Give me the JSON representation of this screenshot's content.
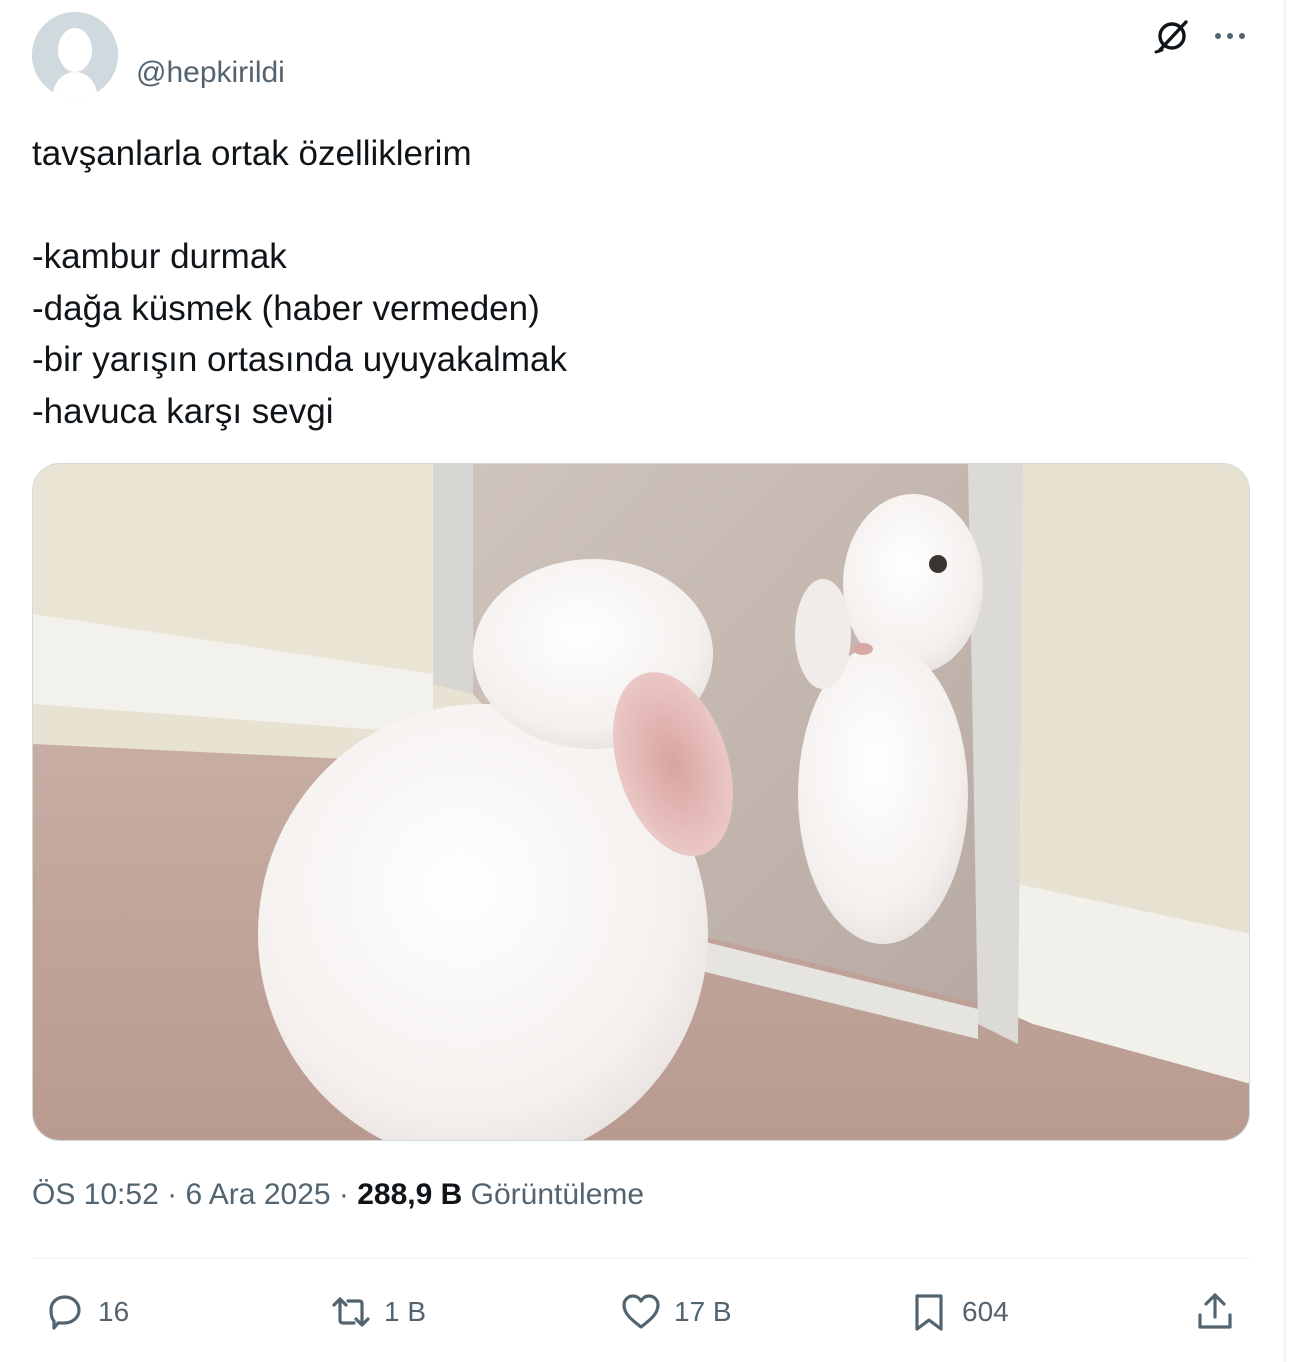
{
  "user": {
    "handle": "@hepkirildi"
  },
  "icons": {
    "grok": "grok-icon",
    "more": "more-icon",
    "reply": "reply-icon",
    "retweet": "retweet-icon",
    "like": "heart-icon",
    "bookmark": "bookmark-icon",
    "share": "share-icon"
  },
  "tweet": {
    "text": "tavşanlarla ortak özelliklerim\n\n-kambur durmak\n-dağa küsmek (haber vermeden)\n-bir yarışın ortasında uyuyakalmak\n-havuca karşı sevgi"
  },
  "meta": {
    "time": "ÖS 10:52",
    "date": "6 Ara 2025",
    "views_count": "288,9 B",
    "views_label": "Görüntüleme"
  },
  "actions": {
    "replies": "16",
    "retweets": "1 B",
    "likes": "17 B",
    "bookmarks": "604"
  },
  "colors": {
    "secondary_text": "#536471",
    "primary_text": "#0f1419",
    "divider": "#eff3f4"
  }
}
